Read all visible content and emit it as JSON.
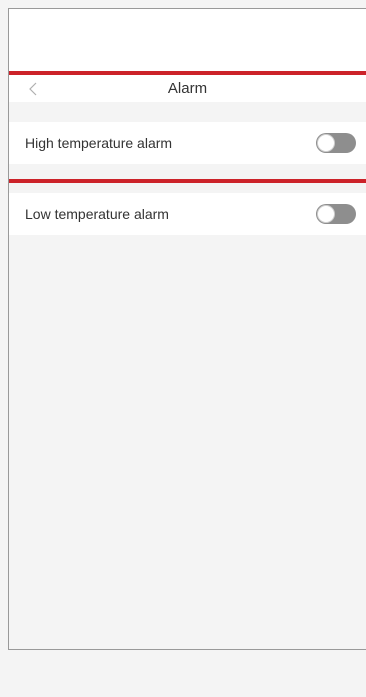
{
  "header": {
    "title": "Alarm",
    "back_icon": "chevron-left-icon"
  },
  "alarms": [
    {
      "label": "High temperature alarm",
      "enabled": false
    },
    {
      "label": "Low temperature alarm",
      "enabled": false
    }
  ],
  "colors": {
    "accent": "#cc2229",
    "toggle_off": "#8e8e8e",
    "background": "#f4f4f4"
  }
}
